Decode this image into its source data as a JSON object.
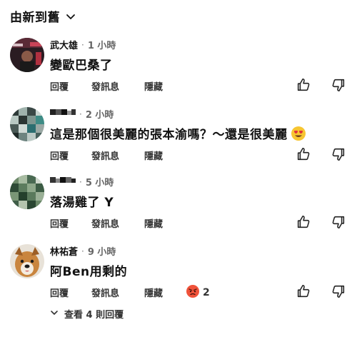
{
  "sort": {
    "label": "由新到舊",
    "icon": "chevron-down-icon"
  },
  "actions": {
    "reply": "回覆",
    "message": "發訊息",
    "hide": "隱藏"
  },
  "comments": [
    {
      "author": "武大雄",
      "time": "1 小時",
      "text": "變歐巴桑了"
    },
    {
      "author": "",
      "time": "2 小時",
      "text": "這是那個很美麗的張本渝嗎？～還是很美麗",
      "emoji": "heart-eyes-emoji"
    },
    {
      "author": "",
      "time": "5 小時",
      "text": "落湯雞了 Y"
    },
    {
      "author": "林祐蒼",
      "time": "9 小時",
      "text": "阿Ben用剩的",
      "reaction": {
        "emoji": "angry-face-emoji",
        "count": "2"
      }
    }
  ],
  "show_replies": "查看 4 則回覆",
  "separator": "·",
  "colors": {
    "text": "#111111",
    "secondary": "#666666",
    "background": "#ffffff"
  }
}
